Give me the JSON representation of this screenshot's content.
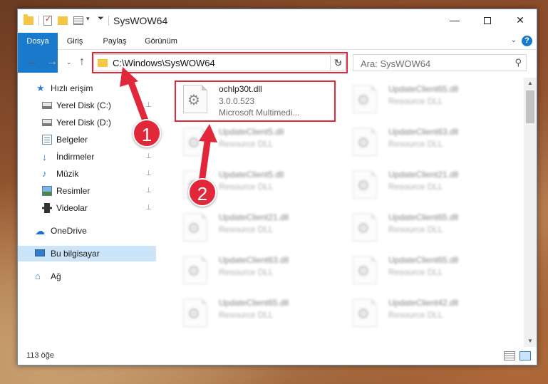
{
  "window": {
    "title": "SysWOW64",
    "controls": {
      "minimize": "—",
      "maximize": "",
      "close": "✕"
    }
  },
  "quick_access_toolbar": {
    "caret": "▾",
    "pin": "⏷"
  },
  "ribbon": {
    "tabs": [
      {
        "label": "Dosya",
        "active": true
      },
      {
        "label": "Giriş"
      },
      {
        "label": "Paylaş"
      },
      {
        "label": "Görünüm"
      }
    ],
    "expand": "⌄",
    "help": "?"
  },
  "navigation": {
    "back": "←",
    "forward": "→",
    "recent": "⌄",
    "up": "↑",
    "address": "C:\\Windows\\SysWOW64",
    "address_dropdown": "⌄",
    "refresh": "↻",
    "search_placeholder": "Ara: SysWOW64",
    "search_icon": "⚲"
  },
  "sidebar": {
    "items": [
      {
        "label": "Hızlı erişim",
        "icon": "star-icon"
      },
      {
        "label": "Yerel Disk (C:)",
        "icon": "drive-icon",
        "pinned": true
      },
      {
        "label": "Yerel Disk (D:)",
        "icon": "drive-icon"
      },
      {
        "label": "Belgeler",
        "icon": "documents-icon"
      },
      {
        "label": "İndirmeler",
        "icon": "downloads-icon",
        "pinned": true
      },
      {
        "label": "Müzik",
        "icon": "music-icon",
        "pinned": true
      },
      {
        "label": "Resimler",
        "icon": "pictures-icon",
        "pinned": true
      },
      {
        "label": "Videolar",
        "icon": "videos-icon",
        "pinned": true
      },
      {
        "label": "OneDrive",
        "icon": "onedrive-icon"
      },
      {
        "label": "Bu bilgisayar",
        "icon": "this-pc-icon",
        "selected": true
      },
      {
        "label": "Ağ",
        "icon": "network-icon"
      }
    ],
    "pin_glyph": "📌"
  },
  "files": [
    {
      "name": "ochlp30t.dll",
      "line2": "3.0.0.523",
      "line3": "Microsoft Multimedi...",
      "highlighted": true
    },
    {
      "name": "UpdateClient65.dll",
      "line2": "Resource DLL"
    },
    {
      "name": "UpdateClient5.dll",
      "line2": "Resource DLL"
    },
    {
      "name": "UpdateClient63.dll",
      "line2": "Resource DLL"
    },
    {
      "name": "UpdateClient5.dll",
      "line2": "Resource DLL"
    },
    {
      "name": "UpdateClient21.dll",
      "line2": "Resource DLL"
    },
    {
      "name": "UpdateClient21.dll",
      "line2": "Resource DLL"
    },
    {
      "name": "UpdateClient65.dll",
      "line2": "Resource DLL"
    },
    {
      "name": "UpdateClient63.dll",
      "line2": "Resource DLL"
    },
    {
      "name": "UpdateClient65.dll",
      "line2": "Resource DLL"
    },
    {
      "name": "UpdateClient65.dll",
      "line2": "Resource DLL"
    },
    {
      "name": "UpdateClient42.dll",
      "line2": "Resource DLL"
    }
  ],
  "scrollbar": {
    "up": "▲",
    "down": "▼"
  },
  "status": {
    "count": "113 öğe"
  },
  "callouts": [
    {
      "number": "1"
    },
    {
      "number": "2"
    }
  ],
  "colors": {
    "accent": "#1979ca",
    "highlight_red": "#e0283a",
    "selected_bg": "#cce4f7"
  }
}
